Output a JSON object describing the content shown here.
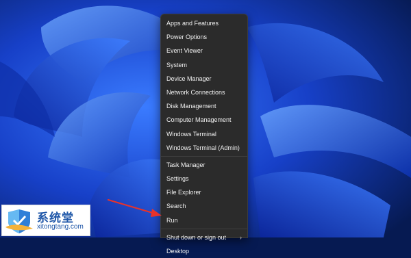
{
  "menu": {
    "groups": [
      [
        "Apps and Features",
        "Power Options",
        "Event Viewer",
        "System",
        "Device Manager",
        "Network Connections",
        "Disk Management",
        "Computer Management",
        "Windows Terminal",
        "Windows Terminal (Admin)"
      ],
      [
        "Task Manager",
        "Settings",
        "File Explorer",
        "Search",
        "Run"
      ],
      [
        "Shut down or sign out",
        "Desktop"
      ]
    ],
    "submenu_chevron": "›"
  },
  "watermark": {
    "cn": "系统堂",
    "en": "xitongtang.com"
  },
  "colors": {
    "menu_bg": "#2b2b2b",
    "menu_text": "#f2f2f2",
    "arrow": "#e8322a",
    "logo_blue": "#1e56a8"
  },
  "icons": {
    "arrow": "red-pointer-arrow-icon",
    "logo": "shield-logo-icon"
  }
}
